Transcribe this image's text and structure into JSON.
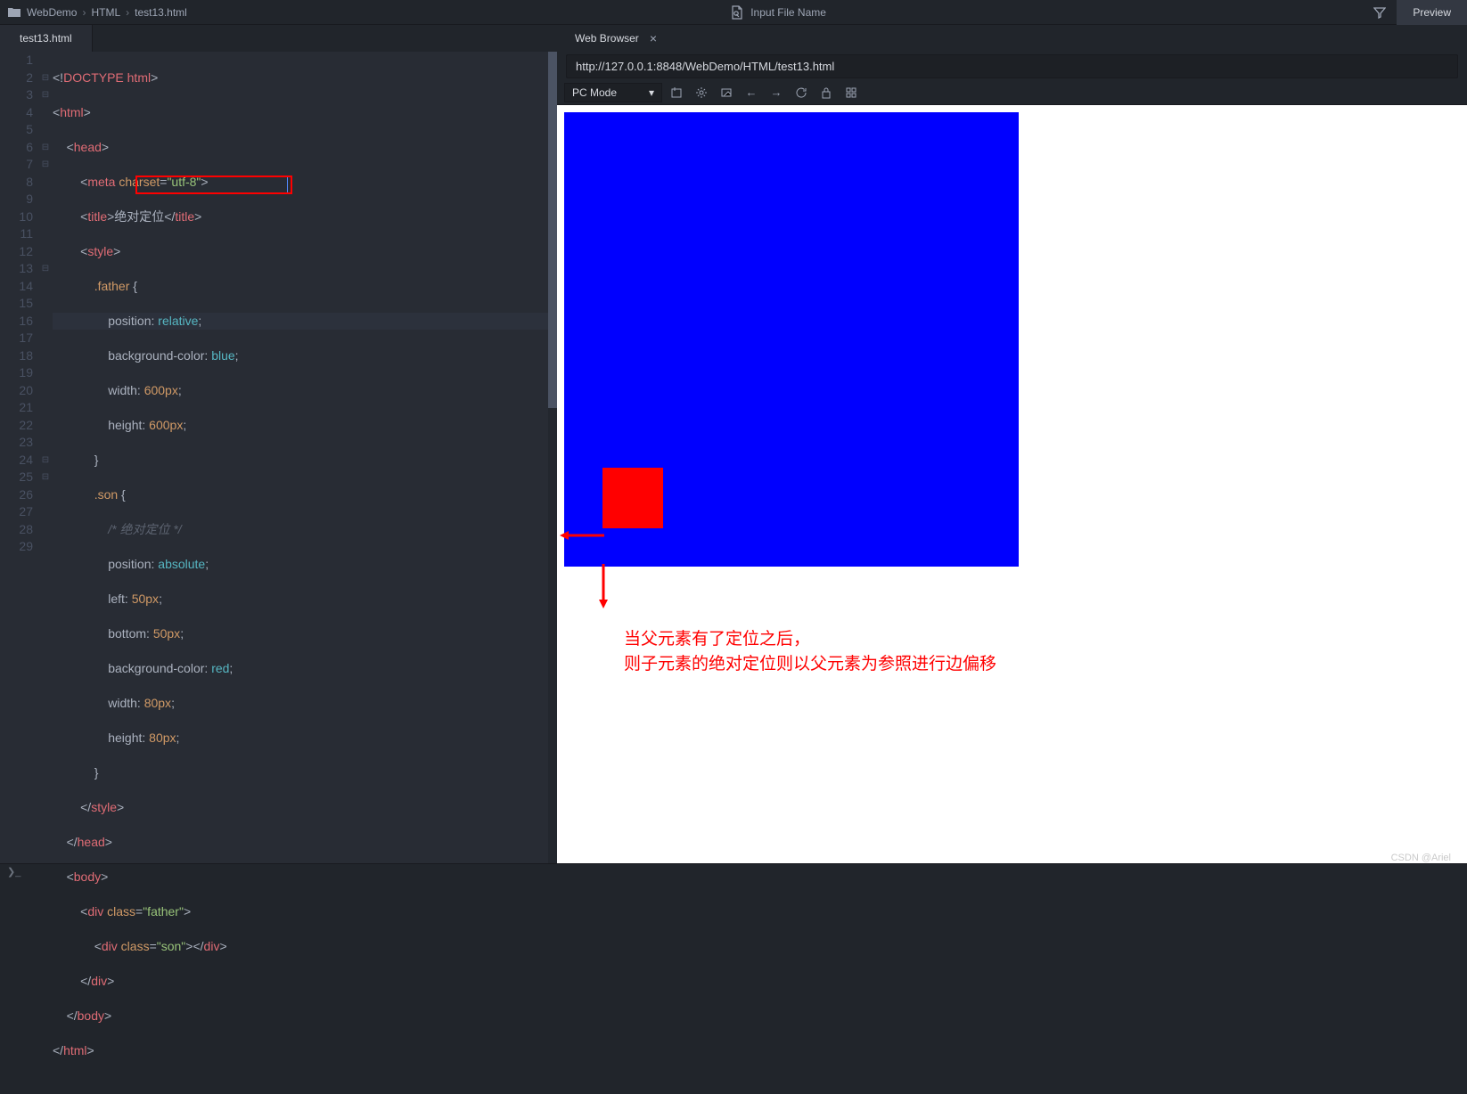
{
  "breadcrumb": {
    "root": "WebDemo",
    "folder": "HTML",
    "file": "test13.html"
  },
  "top": {
    "searchPlaceholder": "Input File Name",
    "previewBtn": "Preview"
  },
  "editor": {
    "tab": "test13.html",
    "lines": [
      "1",
      "2",
      "3",
      "4",
      "5",
      "6",
      "7",
      "8",
      "9",
      "10",
      "11",
      "12",
      "13",
      "14",
      "15",
      "16",
      "17",
      "18",
      "19",
      "20",
      "21",
      "22",
      "23",
      "24",
      "25",
      "26",
      "27",
      "28",
      "29"
    ],
    "code": {
      "l1": {
        "a": "<!",
        "b": "DOCTYPE html",
        "c": ">"
      },
      "l2": {
        "a": "<",
        "b": "html",
        "c": ">"
      },
      "l3": {
        "a": "<",
        "b": "head",
        "c": ">"
      },
      "l4": {
        "a": "<",
        "b": "meta ",
        "attr": "charset",
        "eq": "=",
        "str": "\"utf-8\"",
        "c": ">"
      },
      "l5": {
        "a": "<",
        "b": "title",
        "c": ">",
        "txt": "绝对定位",
        "d": "</",
        "e": "title",
        "f": ">"
      },
      "l6": {
        "a": "<",
        "b": "style",
        "c": ">"
      },
      "l7": {
        "sel": ".father ",
        "brace": "{"
      },
      "l8": {
        "prop": "position",
        "colon": ": ",
        "val": "relative",
        "semi": ";"
      },
      "l9": {
        "prop": "background-color",
        "colon": ": ",
        "val": "blue",
        "semi": ";"
      },
      "l10": {
        "prop": "width",
        "colon": ": ",
        "val": "600px",
        "semi": ";"
      },
      "l11": {
        "prop": "height",
        "colon": ": ",
        "val": "600px",
        "semi": ";"
      },
      "l12": {
        "brace": "}"
      },
      "l13": {
        "sel": ".son ",
        "brace": "{"
      },
      "l14": {
        "cmt": "/* 绝对定位 */"
      },
      "l15": {
        "prop": "position",
        "colon": ": ",
        "val": "absolute",
        "semi": ";"
      },
      "l16": {
        "prop": "left",
        "colon": ": ",
        "val": "50px",
        "semi": ";"
      },
      "l17": {
        "prop": "bottom",
        "colon": ": ",
        "val": "50px",
        "semi": ";"
      },
      "l18": {
        "prop": "background-color",
        "colon": ": ",
        "val": "red",
        "semi": ";"
      },
      "l19": {
        "prop": "width",
        "colon": ": ",
        "val": "80px",
        "semi": ";"
      },
      "l20": {
        "prop": "height",
        "colon": ": ",
        "val": "80px",
        "semi": ";"
      },
      "l21": {
        "brace": "}"
      },
      "l22": {
        "a": "</",
        "b": "style",
        "c": ">"
      },
      "l23": {
        "a": "</",
        "b": "head",
        "c": ">"
      },
      "l24": {
        "a": "<",
        "b": "body",
        "c": ">"
      },
      "l25": {
        "a": "<",
        "b": "div ",
        "attr": "class",
        "eq": "=",
        "str": "\"father\"",
        "c": ">"
      },
      "l26": {
        "a": "<",
        "b": "div ",
        "attr": "class",
        "eq": "=",
        "str": "\"son\"",
        "c": ">",
        "d": "</",
        "e": "div",
        "f": ">"
      },
      "l27": {
        "a": "</",
        "b": "div",
        "c": ">"
      },
      "l28": {
        "a": "</",
        "b": "body",
        "c": ">"
      },
      "l29": {
        "a": "</",
        "b": "html",
        "c": ">"
      }
    }
  },
  "browser": {
    "tab": "Web Browser",
    "url": "http://127.0.0.1:8848/WebDemo/HTML/test13.html",
    "mode": "PC Mode",
    "note1": "当父元素有了定位之后，",
    "note2": "则子元素的绝对定位则以父元素为参照进行边偏移"
  },
  "watermark": "CSDN @Ariel"
}
